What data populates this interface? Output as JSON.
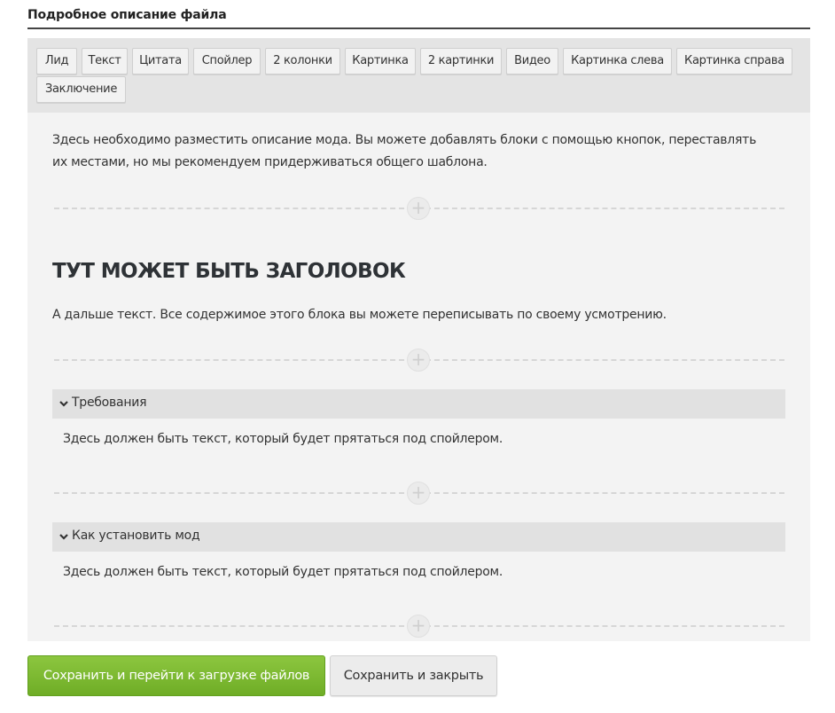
{
  "section": {
    "title": "Подробное описание файла"
  },
  "toolbar": {
    "buttons": [
      "Лид",
      "Текст",
      "Цитата",
      "Спойлер",
      "2 колонки",
      "Картинка",
      "2 картинки",
      "Видео",
      "Картинка слева",
      "Картинка справа",
      "Заключение"
    ]
  },
  "editor": {
    "intro_line1": "Здесь необходимо разместить описание мода. Вы можете добавлять блоки с помощью кнопок, переставлять",
    "intro_line2": "их местами, но мы рекомендуем придерживаться общего шаблона.",
    "heading": "ТУТ МОЖЕТ БЫТЬ ЗАГОЛОВОК",
    "body_text": "А дальше текст. Все содержимое этого блока вы можете переписывать по своему усмотрению.",
    "spoilers": [
      {
        "title": "Требования",
        "text": "Здесь должен быть текст, который будет прятаться под спойлером."
      },
      {
        "title": "Как установить мод",
        "text": "Здесь должен быть текст, который будет прятаться под спойлером."
      }
    ],
    "add_block_glyph": "+"
  },
  "actions": {
    "save_continue": "Сохранить и перейти к загрузке файлов",
    "save_close": "Сохранить и закрыть"
  },
  "colors": {
    "primary_button": "#7ab82f",
    "toolbar_bg": "#e4e4e4",
    "editor_bg": "#f3f3f3",
    "spoiler_header_bg": "#e1e1e1"
  }
}
